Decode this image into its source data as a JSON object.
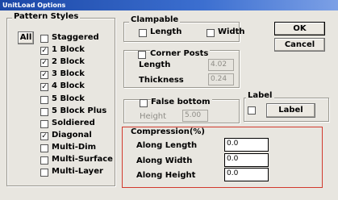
{
  "window": {
    "title": "UnitLoad Options"
  },
  "pattern_styles": {
    "title": "Pattern Styles",
    "all_button": "All",
    "items": [
      {
        "label": "Staggered",
        "checked": false
      },
      {
        "label": "1 Block",
        "checked": true
      },
      {
        "label": "2 Block",
        "checked": true
      },
      {
        "label": "3 Block",
        "checked": true
      },
      {
        "label": "4 Block",
        "checked": true
      },
      {
        "label": "5 Block",
        "checked": false
      },
      {
        "label": "5 Block Plus",
        "checked": false
      },
      {
        "label": "Soldiered",
        "checked": false
      },
      {
        "label": "Diagonal",
        "checked": true
      },
      {
        "label": "Multi-Dim",
        "checked": false
      },
      {
        "label": "Multi-Surface",
        "checked": false
      },
      {
        "label": "Multi-Layer",
        "checked": false
      }
    ]
  },
  "clampable": {
    "title": "Clampable",
    "length_label": "Length",
    "width_label": "Width"
  },
  "corner_posts": {
    "checkbox_label": "Corner Posts",
    "length_label": "Length",
    "length_value": "4.02",
    "thickness_label": "Thickness",
    "thickness_value": "0.24"
  },
  "false_bottom": {
    "checkbox_label": "False bottom",
    "height_label": "Height",
    "height_value": "5.00"
  },
  "label_group": {
    "title": "Label",
    "button": "Label"
  },
  "buttons": {
    "ok": "OK",
    "cancel": "Cancel"
  },
  "compression": {
    "title": "Compression(%)",
    "along_length_label": "Along Length",
    "along_length_value": "0.0",
    "along_width_label": "Along Width",
    "along_width_value": "0.0",
    "along_height_label": "Along Height",
    "along_height_value": "0.0"
  },
  "colors": {
    "highlight": "#d23a2e",
    "titlebar": "#1b47a6"
  }
}
